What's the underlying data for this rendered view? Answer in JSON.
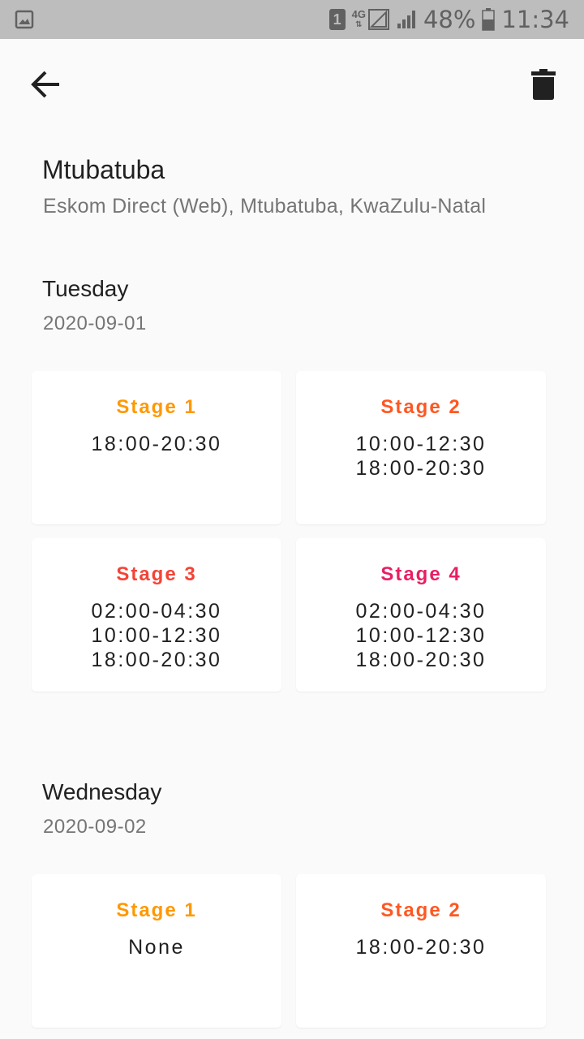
{
  "status_bar": {
    "sim_number": "1",
    "network": "4G",
    "battery_percent": "48%",
    "time": "11:34",
    "icons": [
      "image-icon",
      "sim-icon",
      "signal-4g-icon",
      "signal-icon",
      "battery-icon"
    ]
  },
  "header": {
    "back_icon": "arrow-back-icon",
    "delete_icon": "trash-icon"
  },
  "area": {
    "title": "Mtubatuba",
    "subtitle": "Eskom Direct (Web), Mtubatuba, KwaZulu-Natal"
  },
  "days": [
    {
      "name": "Tuesday",
      "date": "2020-09-01",
      "stages": [
        {
          "label": "Stage 1",
          "color": "#ff9800",
          "times": [
            "18:00-20:30"
          ]
        },
        {
          "label": "Stage 2",
          "color": "#ff5722",
          "times": [
            "10:00-12:30",
            "18:00-20:30"
          ]
        },
        {
          "label": "Stage 3",
          "color": "#f44336",
          "times": [
            "02:00-04:30",
            "10:00-12:30",
            "18:00-20:30"
          ]
        },
        {
          "label": "Stage 4",
          "color": "#e91e63",
          "times": [
            "02:00-04:30",
            "10:00-12:30",
            "18:00-20:30"
          ]
        }
      ]
    },
    {
      "name": "Wednesday",
      "date": "2020-09-02",
      "stages": [
        {
          "label": "Stage 1",
          "color": "#ff9800",
          "times": [
            "None"
          ]
        },
        {
          "label": "Stage 2",
          "color": "#ff5722",
          "times": [
            "18:00-20:30"
          ]
        }
      ]
    }
  ]
}
